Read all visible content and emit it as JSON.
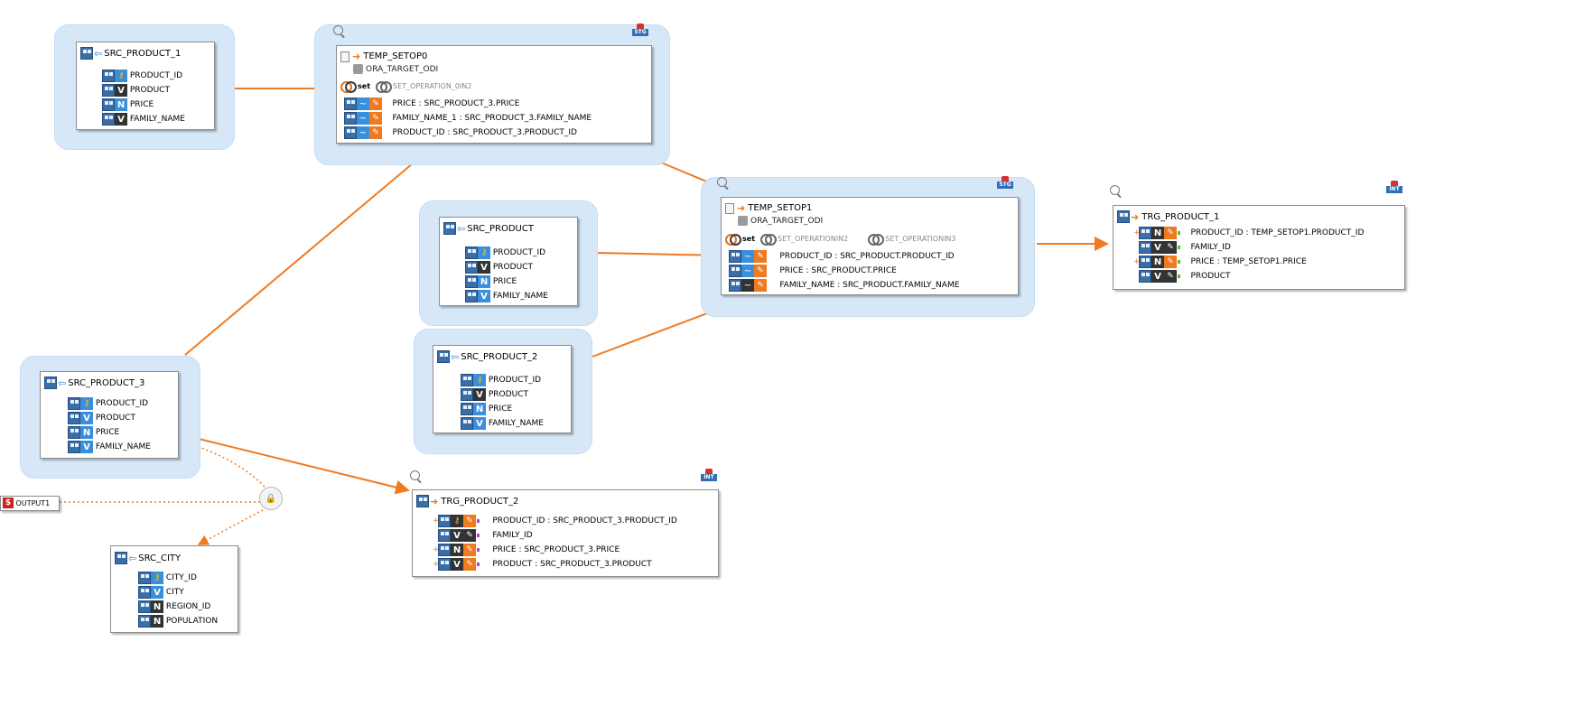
{
  "nodes": {
    "src_product_1": {
      "title": "SRC_PRODUCT_1",
      "attrs": [
        {
          "name": "PRODUCT_ID",
          "type": "key"
        },
        {
          "name": "PRODUCT",
          "type": "V"
        },
        {
          "name": "PRICE",
          "type": "N"
        },
        {
          "name": "FAMILY_NAME",
          "type": "V"
        }
      ]
    },
    "temp_setop0": {
      "title": "TEMP_SETOP0",
      "schema": "ORA_TARGET_ODI",
      "set_label": "set",
      "set_ops": [
        "SET_OPERATION_0IN2"
      ],
      "badge": "STG",
      "attrs": [
        "PRICE : SRC_PRODUCT_3.PRICE",
        "FAMILY_NAME_1 : SRC_PRODUCT_3.FAMILY_NAME",
        "PRODUCT_ID : SRC_PRODUCT_3.PRODUCT_ID"
      ]
    },
    "src_product": {
      "title": "SRC_PRODUCT",
      "attrs": [
        {
          "name": "PRODUCT_ID",
          "type": "key"
        },
        {
          "name": "PRODUCT",
          "type": "V"
        },
        {
          "name": "PRICE",
          "type": "N"
        },
        {
          "name": "FAMILY_NAME",
          "type": "V"
        }
      ]
    },
    "src_product_2": {
      "title": "SRC_PRODUCT_2",
      "attrs": [
        {
          "name": "PRODUCT_ID",
          "type": "key"
        },
        {
          "name": "PRODUCT",
          "type": "V"
        },
        {
          "name": "PRICE",
          "type": "N"
        },
        {
          "name": "FAMILY_NAME",
          "type": "V"
        }
      ]
    },
    "temp_setop1": {
      "title": "TEMP_SETOP1",
      "schema": "ORA_TARGET_ODI",
      "set_label": "set",
      "set_ops": [
        "SET_OPERATIONIN2",
        "SET_OPERATIONIN3"
      ],
      "badge": "STG",
      "attrs": [
        "PRODUCT_ID : SRC_PRODUCT.PRODUCT_ID",
        "PRICE : SRC_PRODUCT.PRICE",
        "FAMILY_NAME : SRC_PRODUCT.FAMILY_NAME"
      ]
    },
    "trg_product_1": {
      "title": "TRG_PRODUCT_1",
      "badge": "INT",
      "attrs": [
        "PRODUCT_ID : TEMP_SETOP1.PRODUCT_ID",
        "FAMILY_ID",
        "PRICE : TEMP_SETOP1.PRICE",
        "PRODUCT"
      ]
    },
    "src_product_3": {
      "title": "SRC_PRODUCT_3",
      "attrs": [
        {
          "name": "PRODUCT_ID",
          "type": "key"
        },
        {
          "name": "PRODUCT",
          "type": "V"
        },
        {
          "name": "PRICE",
          "type": "N"
        },
        {
          "name": "FAMILY_NAME",
          "type": "V"
        }
      ]
    },
    "trg_product_2": {
      "title": "TRG_PRODUCT_2",
      "badge": "INT",
      "attrs": [
        "PRODUCT_ID : SRC_PRODUCT_3.PRODUCT_ID",
        "FAMILY_ID",
        "PRICE : SRC_PRODUCT_3.PRICE",
        "PRODUCT : SRC_PRODUCT_3.PRODUCT"
      ]
    },
    "src_city": {
      "title": "SRC_CITY",
      "attrs": [
        {
          "name": "CITY_ID",
          "type": "key"
        },
        {
          "name": "CITY",
          "type": "V"
        },
        {
          "name": "REGION_ID",
          "type": "N"
        },
        {
          "name": "POPULATION",
          "type": "N"
        }
      ]
    },
    "output1": {
      "title": "OUTPUT1"
    }
  },
  "colors": {
    "flow": "#f07a20",
    "group": "#d6e7f8",
    "key": "#f4c020",
    "type_blue": "#3a8fdc",
    "type_dark": "#333333"
  }
}
